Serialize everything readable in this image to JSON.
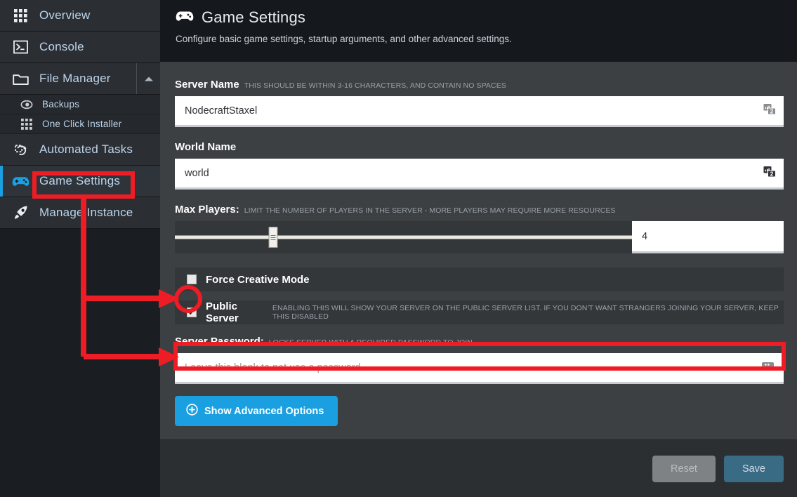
{
  "sidebar": {
    "items": [
      {
        "label": "Overview",
        "icon": "grid-icon",
        "level": "top",
        "active": false
      },
      {
        "label": "Console",
        "icon": "terminal-icon",
        "level": "top",
        "active": false
      },
      {
        "label": "File Manager",
        "icon": "folder-icon",
        "level": "top",
        "active": false,
        "expander": "chevron-up-icon"
      },
      {
        "label": "Backups",
        "icon": "backup-icon",
        "level": "sub",
        "active": false
      },
      {
        "label": "One Click Installer",
        "icon": "grid-icon",
        "level": "sub",
        "active": false
      },
      {
        "label": "Automated Tasks",
        "icon": "tasks-refresh-icon",
        "level": "top",
        "active": false
      },
      {
        "label": "Game Settings",
        "icon": "gamepad-icon",
        "level": "top",
        "active": true
      },
      {
        "label": "Manage Instance",
        "icon": "rocket-icon",
        "level": "top",
        "active": false
      }
    ]
  },
  "header": {
    "icon": "gamepad-icon",
    "title": "Game Settings",
    "subtitle": "Configure basic game settings, startup arguments, and other advanced settings."
  },
  "form": {
    "server_name": {
      "label": "Server Name",
      "hint": "THIS SHOULD BE WITHIN 3-16 CHARACTERS, AND CONTAIN NO SPACES",
      "value": "NodecraftStaxel",
      "badge_icon": "password-manager-badge-icon",
      "badge_count": "2"
    },
    "world_name": {
      "label": "World Name",
      "hint": "",
      "value": "world",
      "badge_icon": "password-manager-badge-icon",
      "badge_count": "2"
    },
    "max_players": {
      "label": "Max Players:",
      "hint": "LIMIT THE NUMBER OF PLAYERS IN THE SERVER - MORE PLAYERS MAY REQUIRE MORE RESOURCES",
      "value": "4",
      "slider_percent": 21.5
    },
    "force_creative": {
      "label": "Force Creative Mode",
      "hint": "",
      "checked": false
    },
    "public_server": {
      "label": "Public Server",
      "hint": "ENABLING THIS WILL SHOW YOUR SERVER ON THE PUBLIC SERVER LIST. IF YOU DON'T WANT STRANGERS JOINING YOUR SERVER, KEEP THIS DISABLED",
      "checked": true,
      "tick": "✔"
    },
    "server_password": {
      "label": "Server Password:",
      "hint": "LOCKS SERVER WITH A REQUIRED PASSWORD TO JOIN",
      "value": "",
      "placeholder": "Leave this blank to not use a password.",
      "badge_icon": "key-manager-icon"
    },
    "advanced_button": {
      "label": "Show Advanced Options",
      "icon": "plus-circle-icon"
    }
  },
  "footer": {
    "reset_label": "Reset",
    "save_label": "Save"
  },
  "annotations": {
    "color": "#ee1c24",
    "marks": [
      "highlight-box-game-settings",
      "arrow-to-public-server-checkbox",
      "circle-public-server-checkbox",
      "arrow-to-server-password-field",
      "highlight-box-server-password-field"
    ]
  },
  "colors": {
    "accent": "#1a9fe0",
    "annotation": "#ee1c24",
    "sidebar_bg": "#1a1d21",
    "content_bg": "#3c4043",
    "header_bg": "#15191e",
    "save_bg": "#3a6b85"
  }
}
